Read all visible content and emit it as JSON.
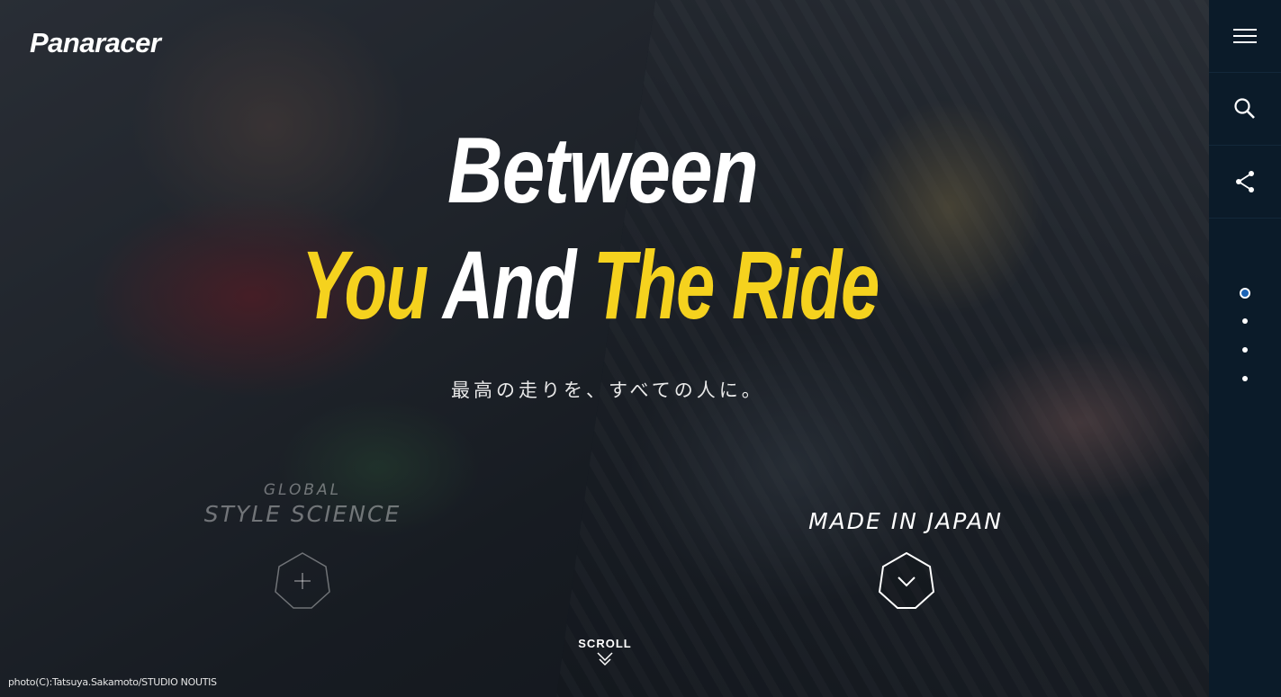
{
  "brand": {
    "logo": "Panaracer"
  },
  "hero": {
    "headline_1": "Between",
    "headline_2": {
      "part1": "You",
      "part2": "And",
      "part3": "The Ride"
    },
    "tagline": "最高の走りを、すべての人に。"
  },
  "features": [
    {
      "small": "GLOBAL",
      "big": "STYLE SCIENCE",
      "icon": "plus-icon"
    },
    {
      "small": "",
      "big": "MADE IN JAPAN",
      "icon": "chevron-down-icon"
    }
  ],
  "scroll": {
    "label": "SCROLL"
  },
  "credit": "photo(C):Tatsuya.Sakamoto/STUDIO NOUTIS",
  "sidebar": {
    "menu_icon": "hamburger-menu-icon",
    "search_icon": "search-icon",
    "share_icon": "share-icon",
    "page_dots": 4,
    "active_dot": 1
  },
  "colors": {
    "accent_yellow": "#f5d21e",
    "sidebar_bg": "#0b1b29",
    "dot_active": "#1b63b5"
  }
}
